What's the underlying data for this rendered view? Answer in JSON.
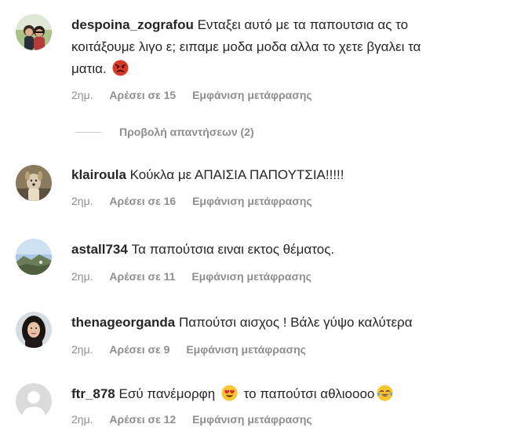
{
  "comments": [
    {
      "username": "despoina_zografou",
      "text_line1": "Ενταξει αυτό με τα παπουτσια ας το",
      "text_line2": "κοιτάξουμε λιγο ε; ειπαμε μοδα μοδα αλλα το χετε βγαλει τα",
      "text_line3": "ματια.",
      "emoji": "angry-face-emoji",
      "time": "2ημ.",
      "likes": "Αρέσει σε 15",
      "translate": "Εμφάνιση μετάφρασης"
    },
    {
      "username": "klairoula",
      "text": "Κούκλα με ΑΠΑΙΣΙΑ ΠΑΠΟΥΤΣΙΑ!!!!!",
      "time": "2ημ.",
      "likes": "Αρέσει σε 16",
      "translate": "Εμφάνιση μετάφρασης"
    },
    {
      "username": "astall734",
      "text": "Τα παπούτσια ειναι εκτος θέματος.",
      "time": "2ημ.",
      "likes": "Αρέσει σε 11",
      "translate": "Εμφάνιση μετάφρασης"
    },
    {
      "username": "thenageorganda",
      "text": "Παπούτσι αισχος ! Βάλε γύψο καλύτερα",
      "time": "2ημ.",
      "likes": "Αρέσει σε 9",
      "translate": "Εμφάνιση μετάφρασης"
    },
    {
      "username": "ftr_878",
      "text_part1": "Εσύ πανέμορφη",
      "text_part2": "το παπούτσι αθλιοοοο",
      "emoji1": "heart-eyes-emoji",
      "emoji2": "tears-of-joy-emoji",
      "time": "2ημ.",
      "likes": "Αρέσει σε 12",
      "translate": "Εμφάνιση μετάφρασης"
    }
  ],
  "view_replies": "Προβολή απαντήσεων (2)",
  "colors": {
    "text": "#262626",
    "meta": "#8e8e8e",
    "divider": "#c7c7c7"
  }
}
